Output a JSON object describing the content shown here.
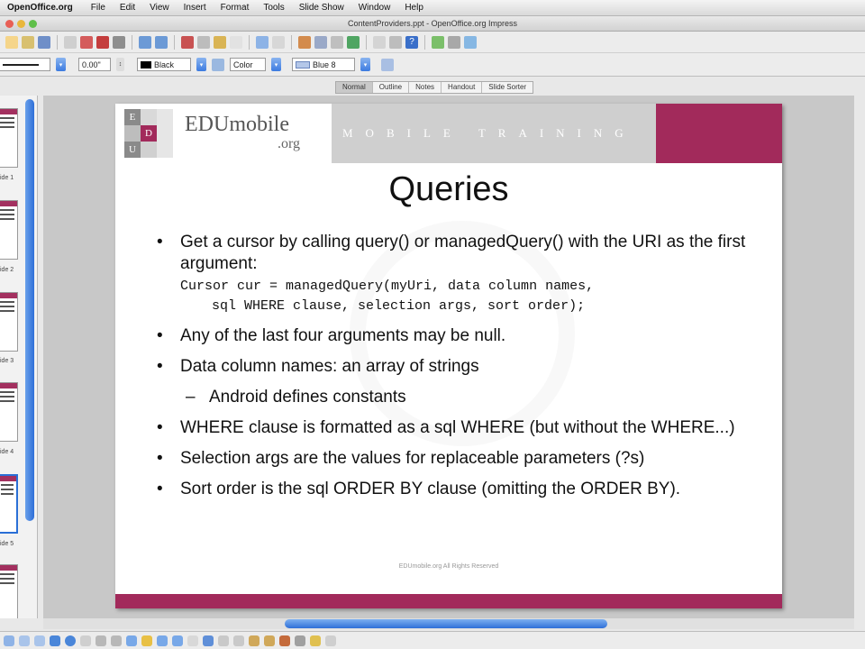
{
  "menubar": {
    "app_name": "OpenOffice.org",
    "items": [
      "File",
      "Edit",
      "View",
      "Insert",
      "Format",
      "Tools",
      "Slide Show",
      "Window",
      "Help"
    ]
  },
  "window": {
    "title": "ContentProviders.ppt - OpenOffice.org Impress"
  },
  "toolbar2": {
    "line_width": "0.00\"",
    "line_color": "Black",
    "area_style": "Color",
    "area_color": "Blue 8"
  },
  "view_tabs": [
    "Normal",
    "Outline",
    "Notes",
    "Handout",
    "Slide Sorter"
  ],
  "slides_panel": {
    "labels": [
      "ide 1",
      "ide 2",
      "ide 3",
      "ide 4",
      "ide 5"
    ]
  },
  "slide": {
    "brand": "EDUmobile",
    "brand_sub": ".org",
    "logo_letters": [
      "E",
      "D",
      "U"
    ],
    "banner_text": "MOBILE TRAINING",
    "title": "Queries",
    "bullets": {
      "b1": "Get a cursor by calling query() or managedQuery() with the URI as the first argument:",
      "code1": "Cursor cur = managedQuery(myUri, data column names,",
      "code2": "sql WHERE clause, selection args, sort order);",
      "b2": "Any of the last four arguments may be null.",
      "b3": "Data column names: an array of strings",
      "b3_sub": "Android defines constants",
      "b4": "WHERE clause is formatted as a sql WHERE (but without the WHERE...)",
      "b5": "Selection args are the values for replaceable parameters (?s)",
      "b6": "Sort order is the sql ORDER BY clause (omitting the ORDER BY)."
    },
    "bullet_char": "•",
    "dash_char": "–",
    "footer": "EDUmobile.org All Rights Reserved",
    "colors": {
      "accent": "#a22a5b",
      "banner_gray": "#cfcfcf"
    }
  }
}
